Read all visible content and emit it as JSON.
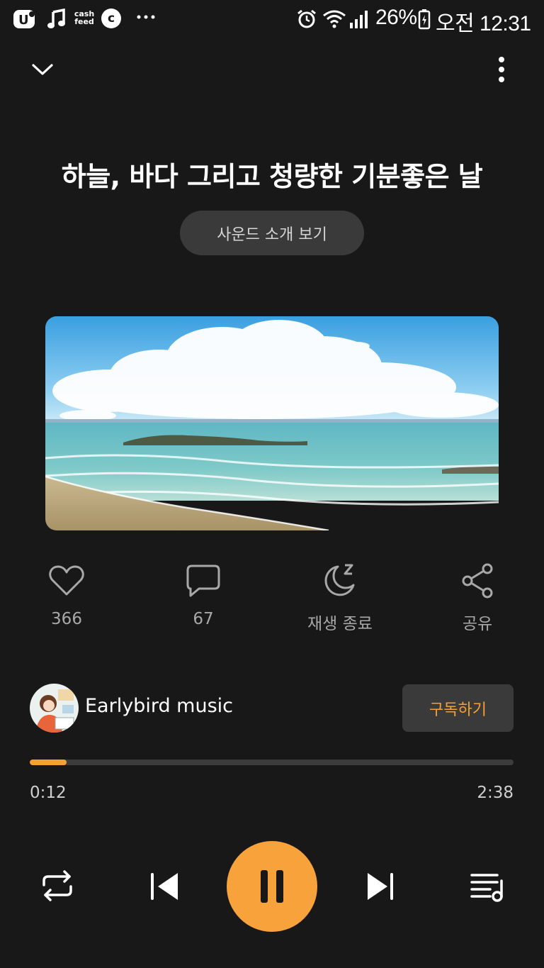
{
  "status_bar": {
    "app_icons": [
      "u-plus-icon",
      "music-note-icon",
      "cashfeed-icon",
      "c-circle-icon",
      "more-dots-icon"
    ],
    "cashfeed_label": "cash feed",
    "c_label": "c",
    "battery_percent": "26%",
    "time": "오전 12:31"
  },
  "header": {
    "title": "하늘, 바다 그리고 청량한 기분좋은 날",
    "intro_button": "사운드 소개 보기"
  },
  "actions": {
    "likes": "366",
    "comments": "67",
    "sleep_timer": "재생 종료",
    "share": "공유"
  },
  "channel": {
    "name": "Earlybird music",
    "subscribe_label": "구독하기"
  },
  "progress": {
    "elapsed": "0:12",
    "duration": "2:38",
    "fraction": 0.076
  },
  "colors": {
    "accent": "#f7a23a",
    "background": "#181818",
    "button_bg": "#3a3a3a"
  }
}
